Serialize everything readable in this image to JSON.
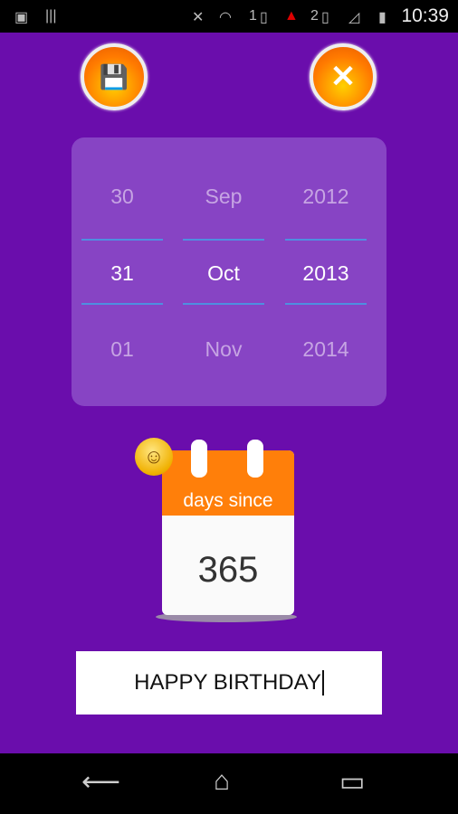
{
  "status_bar": {
    "time": "10:39",
    "sim1": "1",
    "sim2": "2",
    "icons": [
      "image-icon",
      "barcode-icon",
      "mute-icon",
      "wifi-icon",
      "sim-icon",
      "alert-icon",
      "sim-icon",
      "signal-icon",
      "battery-charging-icon"
    ]
  },
  "toolbar": {
    "save_icon": "save-floppy-icon",
    "close_icon": "close-x-icon",
    "close_glyph": "✕"
  },
  "picker": {
    "day": {
      "prev": "30",
      "selected": "31",
      "next": "01"
    },
    "month": {
      "prev": "Sep",
      "selected": "Oct",
      "next": "Nov"
    },
    "year": {
      "prev": "2012",
      "selected": "2013",
      "next": "2014"
    },
    "divider_color": "#4f8fe0"
  },
  "counter": {
    "label": "days since",
    "value": "365",
    "emoji": "☺"
  },
  "message": {
    "value": "HAPPY BIRTHDAY"
  },
  "nav": {
    "back": "⟵",
    "home": "⌂",
    "recents": "▭"
  },
  "colors": {
    "background": "#6a0dac",
    "accent": "#ff7f0a"
  }
}
